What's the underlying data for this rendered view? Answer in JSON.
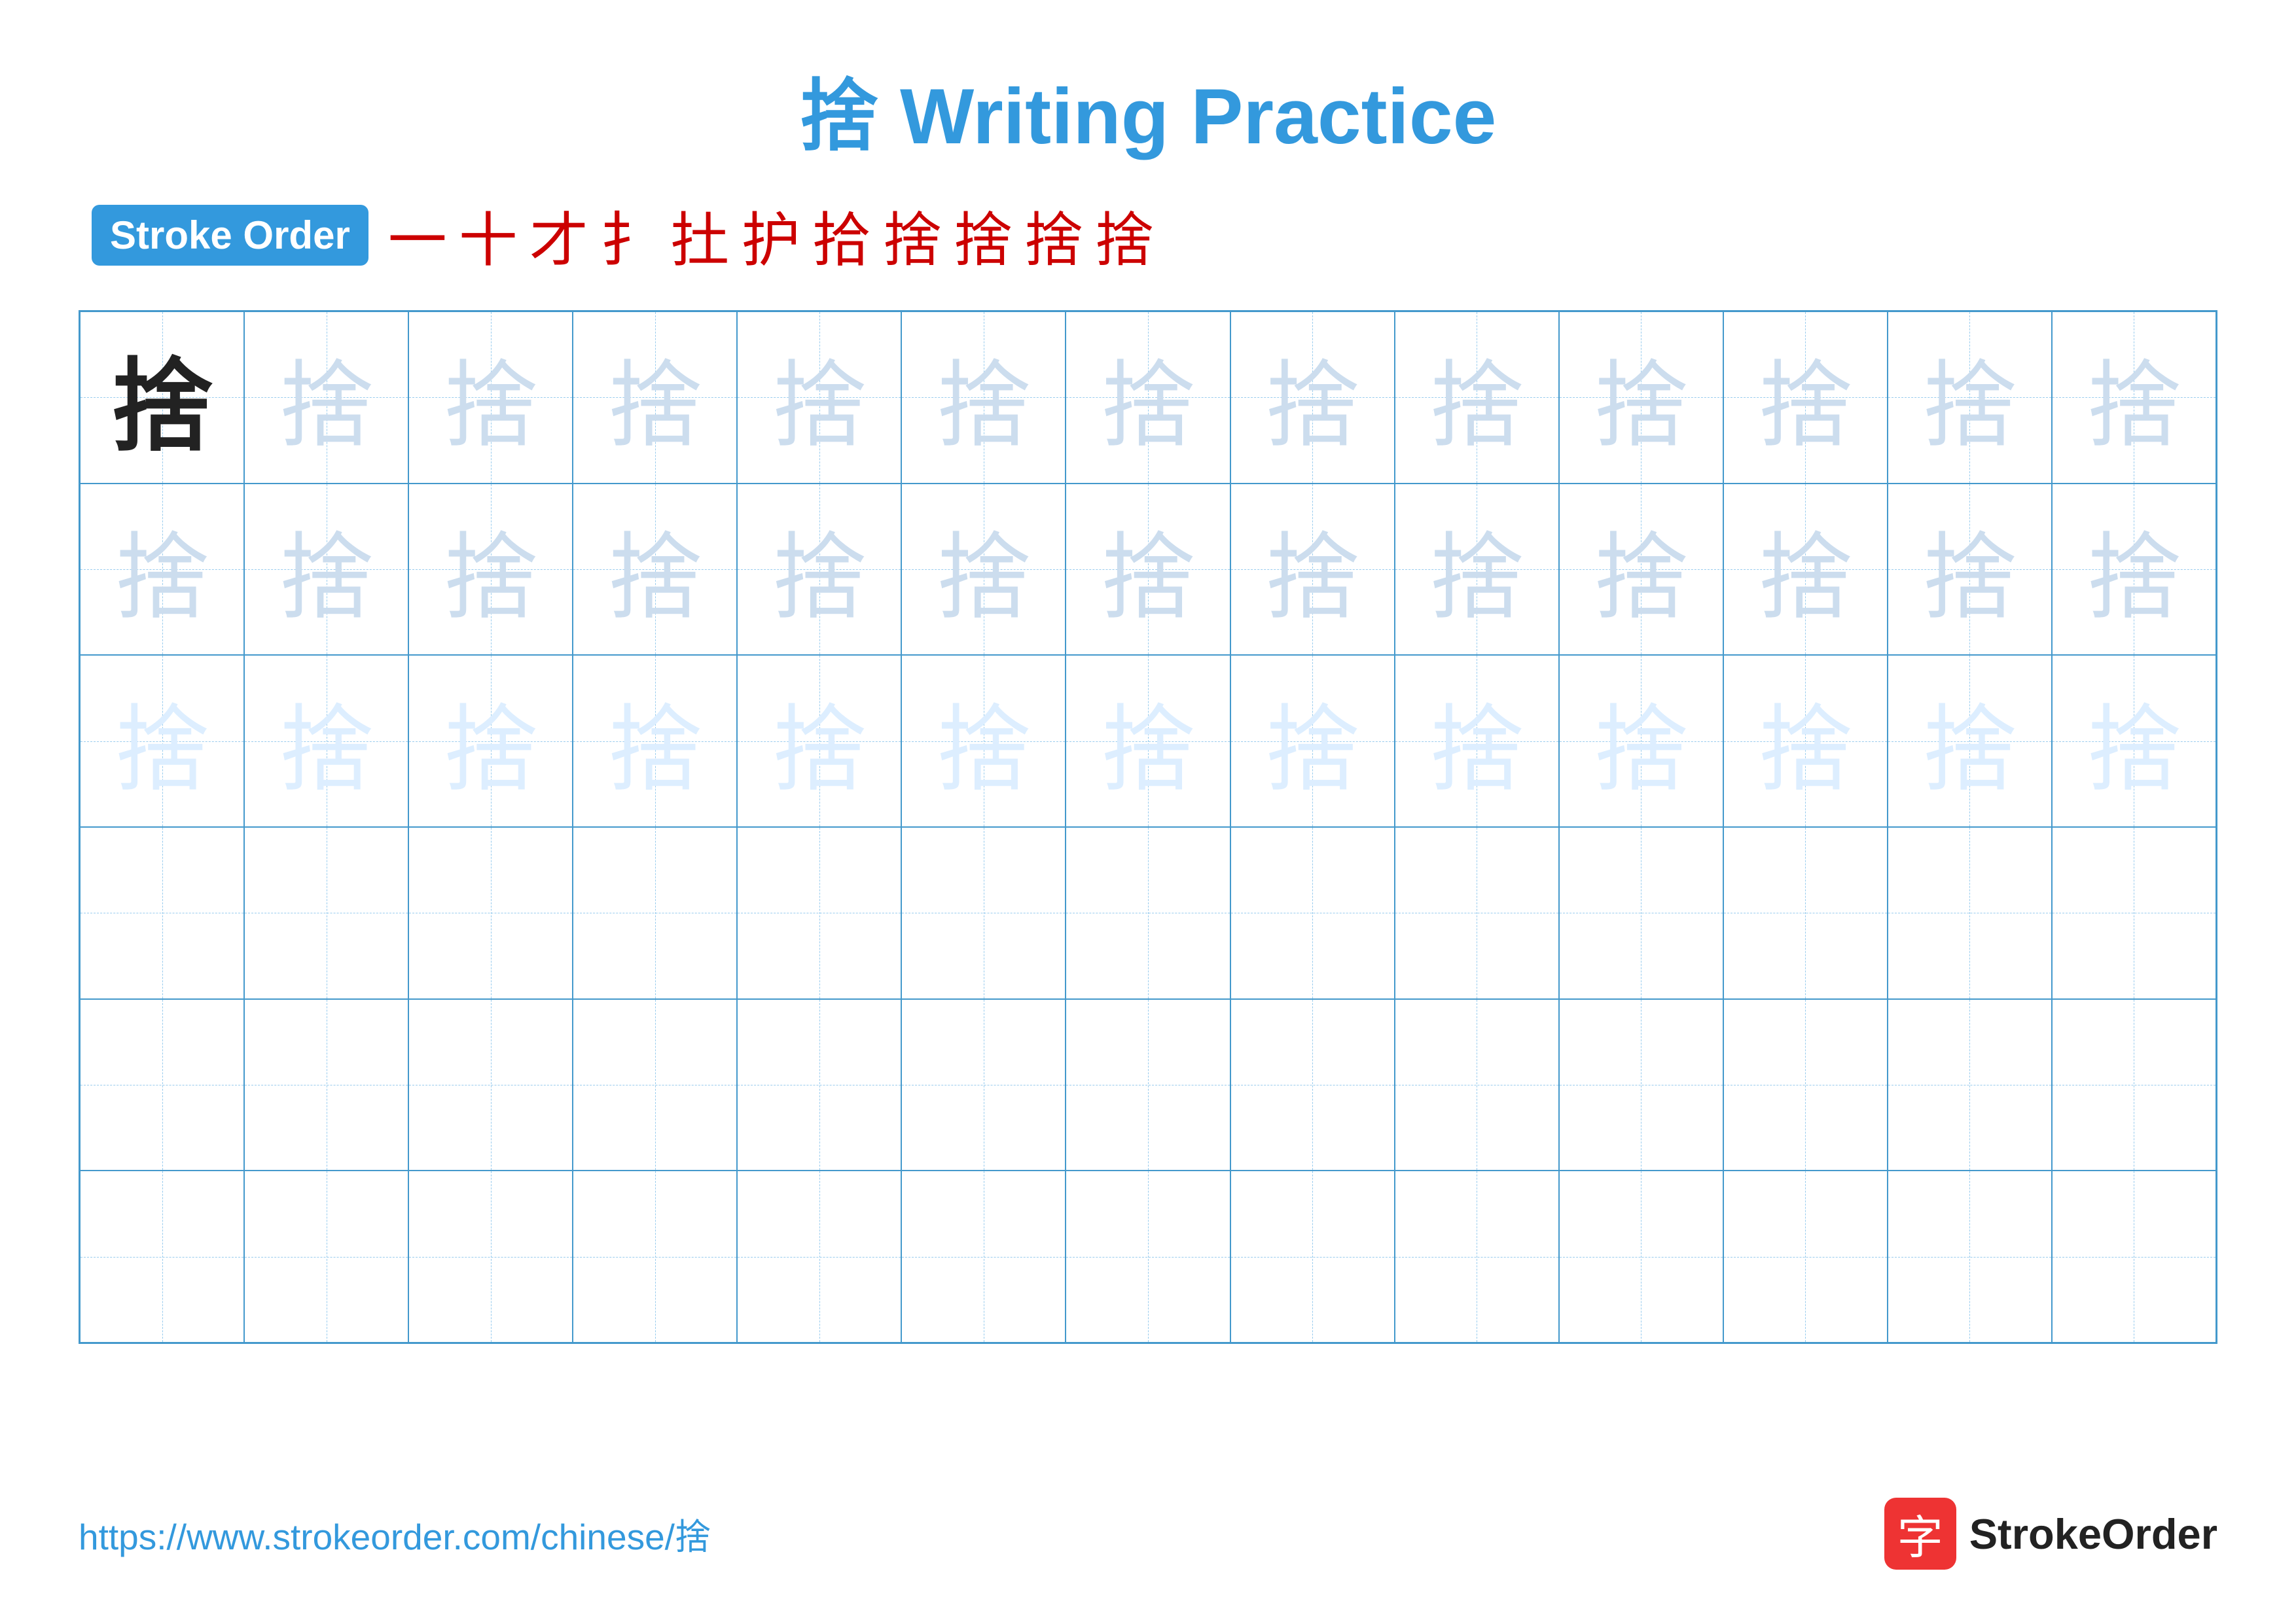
{
  "title": "捨 Writing Practice",
  "stroke_order_badge": "Stroke Order",
  "stroke_sequence": [
    "一",
    "十",
    "才",
    "扌",
    "扗",
    "护",
    "拾",
    "捨",
    "捨",
    "捨",
    "捨"
  ],
  "grid": {
    "cols": 13,
    "rows": 6,
    "char": "捨",
    "row_types": [
      "dark_then_light1",
      "light1",
      "light2",
      "empty",
      "empty",
      "empty"
    ]
  },
  "footer": {
    "url": "https://www.strokeorder.com/chinese/捨",
    "logo_char": "字",
    "logo_text": "StrokeOrder"
  }
}
